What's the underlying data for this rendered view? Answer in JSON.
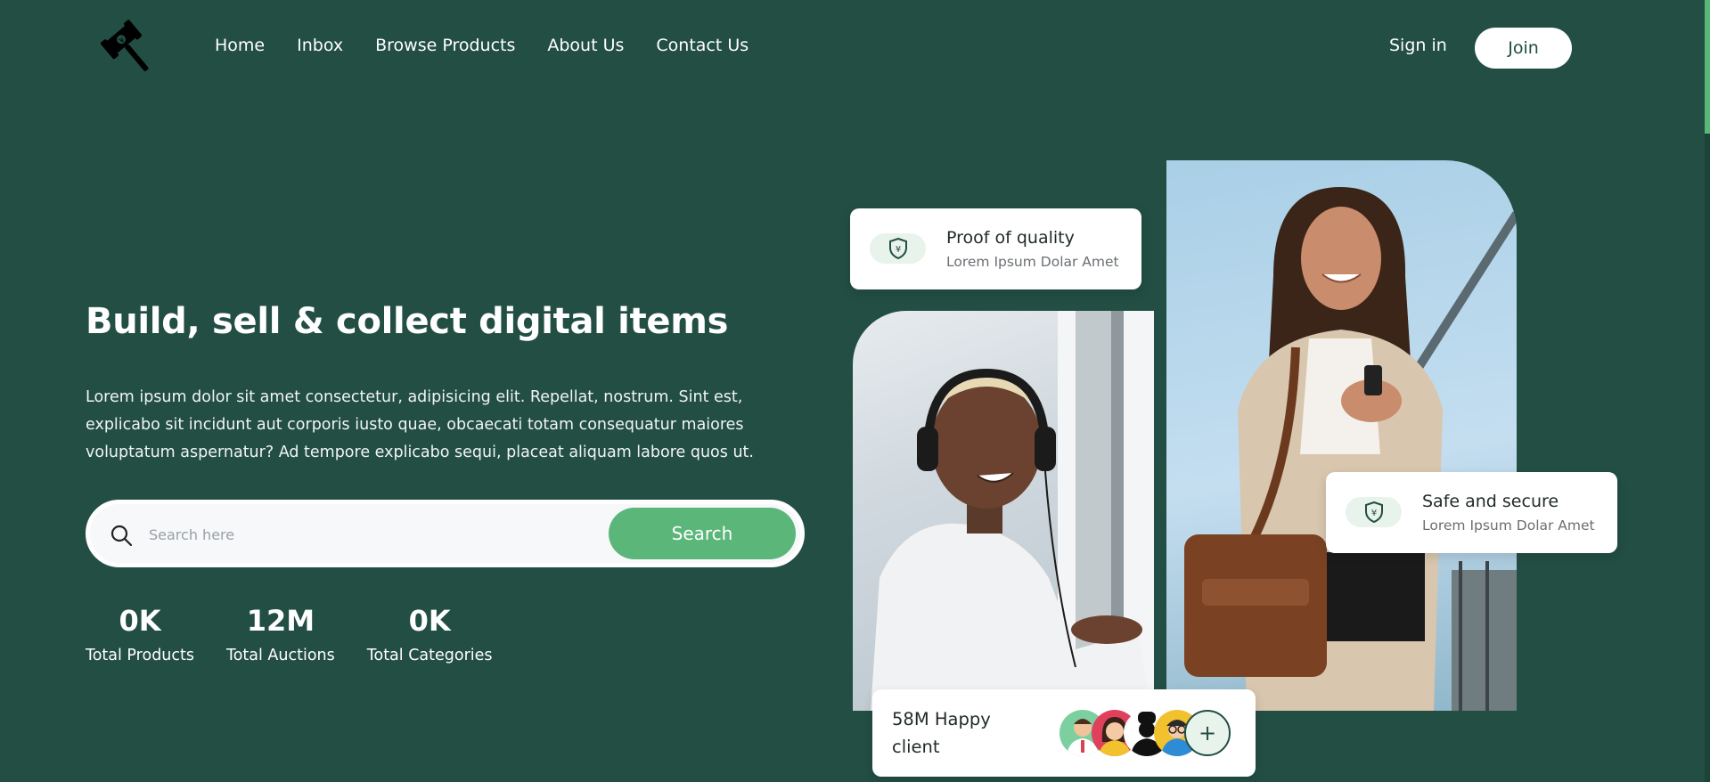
{
  "header": {
    "logo_icon": "gavel-icon",
    "nav": [
      "Home",
      "Inbox",
      "Browse Products",
      "About Us",
      "Contact Us"
    ],
    "sign_in": "Sign in",
    "join": "Join"
  },
  "hero": {
    "title": "Build, sell & collect digital items",
    "description": "Lorem ipsum dolor sit amet consectetur, adipisicing elit. Repellat, nostrum. Sint est, explicabo sit incidunt aut corporis iusto quae, obcaecati totam consequatur maiores voluptatum aspernatur? Ad tempore explicabo sequi, placeat aliquam labore quos ut.",
    "search": {
      "placeholder": "Search here",
      "button": "Search",
      "icon": "search-icon"
    },
    "stats": [
      {
        "value": "0K",
        "label": "Total Products"
      },
      {
        "value": "12M",
        "label": "Total Auctions"
      },
      {
        "value": "0K",
        "label": "Total Categories"
      }
    ]
  },
  "cards": {
    "quality": {
      "title": "Proof of quality",
      "subtitle": "Lorem Ipsum Dolar Amet",
      "icon": "shield-yen-icon"
    },
    "secure": {
      "title": "Safe and secure",
      "subtitle": "Lorem Ipsum Dolar Amet",
      "icon": "shield-yen-icon"
    },
    "clients": {
      "text": "58M Happy client",
      "plus": "+"
    }
  },
  "colors": {
    "background": "#224e43",
    "accent": "#5bb67a",
    "card": "#ffffff"
  }
}
